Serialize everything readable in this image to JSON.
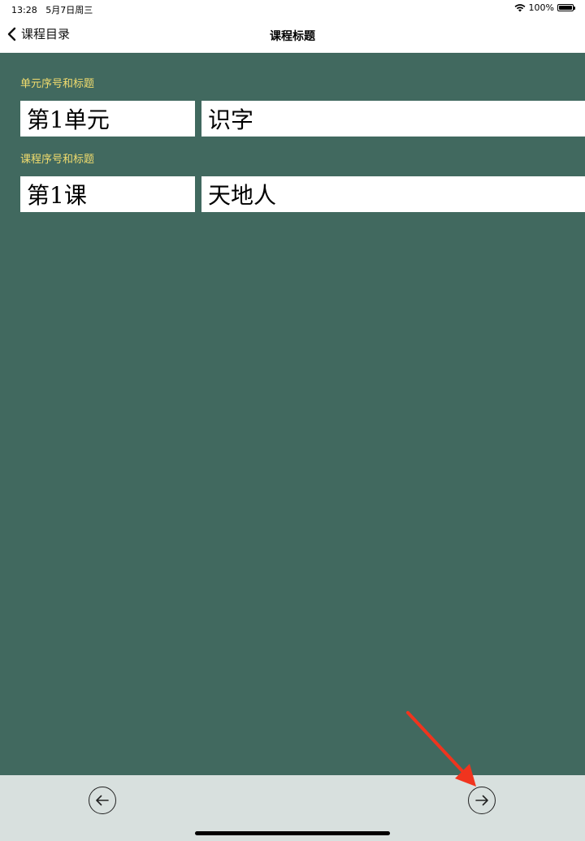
{
  "status_bar": {
    "time": "13:28",
    "date": "5月7日周三",
    "battery": "100%",
    "icons": [
      "wifi-icon",
      "battery-icon"
    ]
  },
  "nav": {
    "back_label": "课程目录",
    "title": "课程标题",
    "back_icon": "chevron-left-icon"
  },
  "unit": {
    "section_label": "单元序号和标题",
    "number": "第1单元",
    "title": "识字"
  },
  "lesson": {
    "section_label": "课程序号和标题",
    "number": "第1课",
    "title": "天地人"
  },
  "toolbar": {
    "prev_icon": "arrow-left-circle-icon",
    "next_icon": "arrow-right-circle-icon"
  },
  "colors": {
    "background": "#41695f",
    "label": "#f1dc6e",
    "toolbar": "#d8e0de",
    "annotation_arrow": "#f0341e"
  }
}
